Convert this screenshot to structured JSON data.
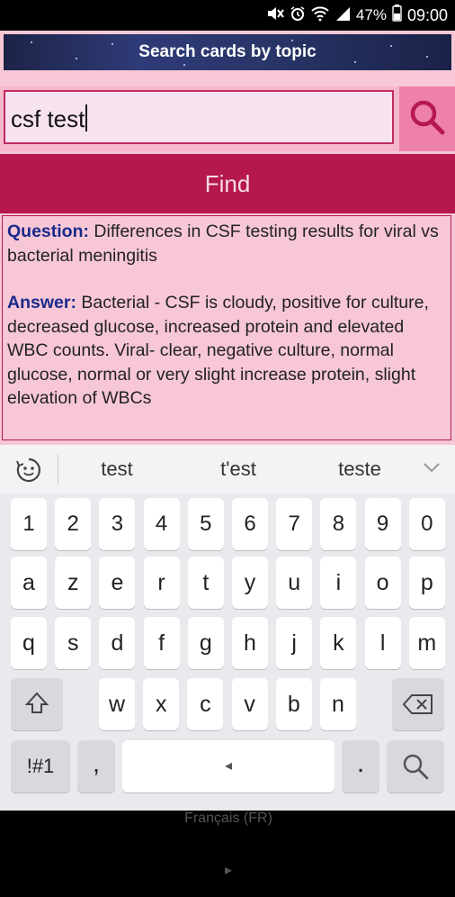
{
  "status_bar": {
    "battery": "47%",
    "time": "09:00"
  },
  "header": {
    "title": "Search cards by topic"
  },
  "search": {
    "value": "csf test"
  },
  "find_label": "Find",
  "card": {
    "question_label": "Question:",
    "question_text": "Differences in CSF testing results for viral vs bacterial meningitis",
    "answer_label": "Answer:",
    "answer_text": "Bacterial - CSF is cloudy, positive for culture, decreased glucose, increased protein and elevated WBC counts. Viral- clear, negative culture, normal glucose, normal or very slight increase protein, slight elevation of WBCs"
  },
  "keyboard": {
    "suggestions": [
      "test",
      "t'est",
      "teste"
    ],
    "row_numbers": [
      "1",
      "2",
      "3",
      "4",
      "5",
      "6",
      "7",
      "8",
      "9",
      "0"
    ],
    "row1": [
      "a",
      "z",
      "e",
      "r",
      "t",
      "y",
      "u",
      "i",
      "o",
      "p"
    ],
    "row2": [
      "q",
      "s",
      "d",
      "f",
      "g",
      "h",
      "j",
      "k",
      "l",
      "m"
    ],
    "row3": [
      "w",
      "x",
      "c",
      "v",
      "b",
      "n"
    ],
    "sym_label": "!#1",
    "comma": ",",
    "space_label": "Français (FR)",
    "period": "."
  }
}
